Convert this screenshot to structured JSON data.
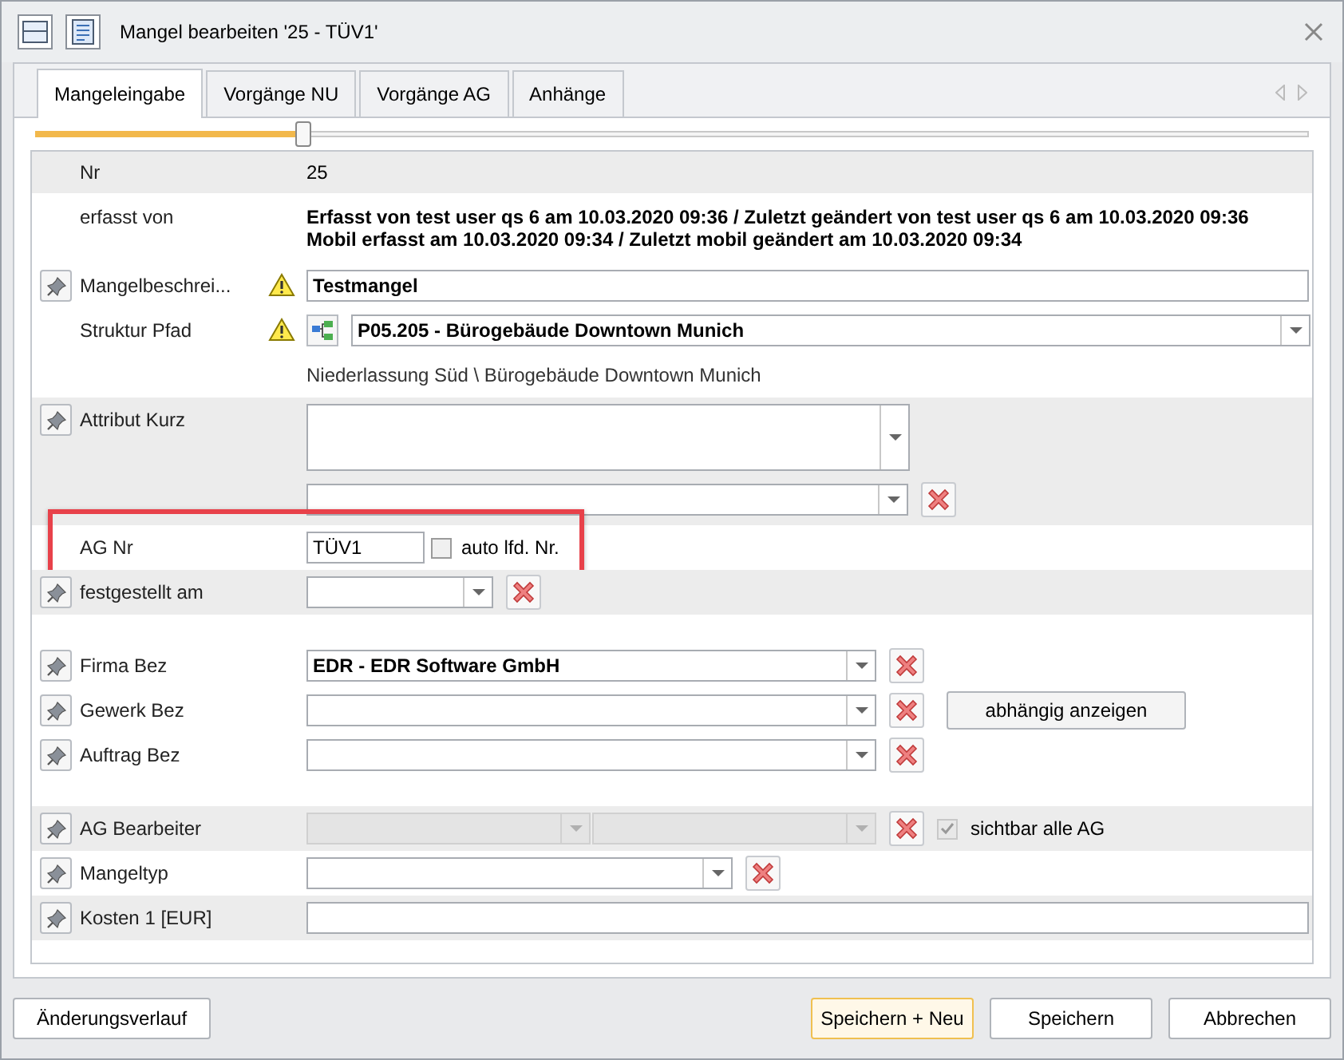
{
  "window": {
    "title": "Mangel bearbeiten '25 - TÜV1'"
  },
  "tabs": [
    {
      "label": "Mangeleingabe",
      "selected": true
    },
    {
      "label": "Vorgänge NU",
      "selected": false
    },
    {
      "label": "Vorgänge AG",
      "selected": false
    },
    {
      "label": "Anhänge",
      "selected": false
    }
  ],
  "slider": {
    "level": 0.21
  },
  "rows": [
    {
      "kind": "text",
      "label": "Nr",
      "value": "25",
      "shaded": true,
      "pin": false
    },
    {
      "kind": "info",
      "label": "erfasst von",
      "lines": [
        "Erfasst von test user qs 6 am 10.03.2020 09:36 / Zuletzt geändert von test user qs 6 am 10.03.2020 09:36",
        "Mobil erfasst am 10.03.2020 09:34 / Zuletzt mobil geändert am 10.03.2020 09:34"
      ],
      "shaded": false,
      "pin": false
    },
    {
      "kind": "input",
      "label": "Mangelbeschrei...",
      "value": "Testmangel",
      "warning": true,
      "shaded": false,
      "pin": true
    },
    {
      "kind": "path",
      "label": "Struktur Pfad",
      "value": "P05.205 - Bürogebäude Downtown Munich",
      "sub": "Niederlassung Süd \\ Bürogebäude Downtown Munich",
      "warning": true,
      "shaded": false,
      "pin": false
    },
    {
      "kind": "multi",
      "label": "Attribut Kurz",
      "shaded": true,
      "pin": true
    },
    {
      "kind": "agnr",
      "label": "AG Nr",
      "value": "TÜV1",
      "check_label": "auto lfd. Nr.",
      "checked": false,
      "highlighted": true,
      "shaded": false,
      "pin": false
    },
    {
      "kind": "date",
      "label": "festgestellt am",
      "shaded": true,
      "pin": true
    },
    {
      "kind": "spacer"
    },
    {
      "kind": "combo",
      "label": "Firma Bez",
      "value": "EDR - EDR Software GmbH",
      "shaded": false,
      "pin": true
    },
    {
      "kind": "combo",
      "label": "Gewerk Bez",
      "button": "abhängig anzeigen",
      "shaded": false,
      "pin": true
    },
    {
      "kind": "combo",
      "label": "Auftrag Bez",
      "shaded": false,
      "pin": true
    },
    {
      "kind": "spacer"
    },
    {
      "kind": "dual",
      "label": "AG Bearbeiter",
      "disabled": true,
      "check_label": "sichtbar alle AG",
      "checked": true,
      "shaded": true,
      "pin": true
    },
    {
      "kind": "combo_short",
      "label": "Mangeltyp",
      "shaded": false,
      "pin": true
    },
    {
      "kind": "input",
      "label": "Kosten 1 [EUR]",
      "warning": false,
      "shaded": true,
      "pin": true
    }
  ],
  "footer": {
    "left": "Änderungsverlauf",
    "buttons": [
      {
        "label": "Speichern + Neu",
        "selected": true
      },
      {
        "label": "Speichern",
        "selected": false
      },
      {
        "label": "Abbrechen",
        "selected": false
      }
    ]
  }
}
